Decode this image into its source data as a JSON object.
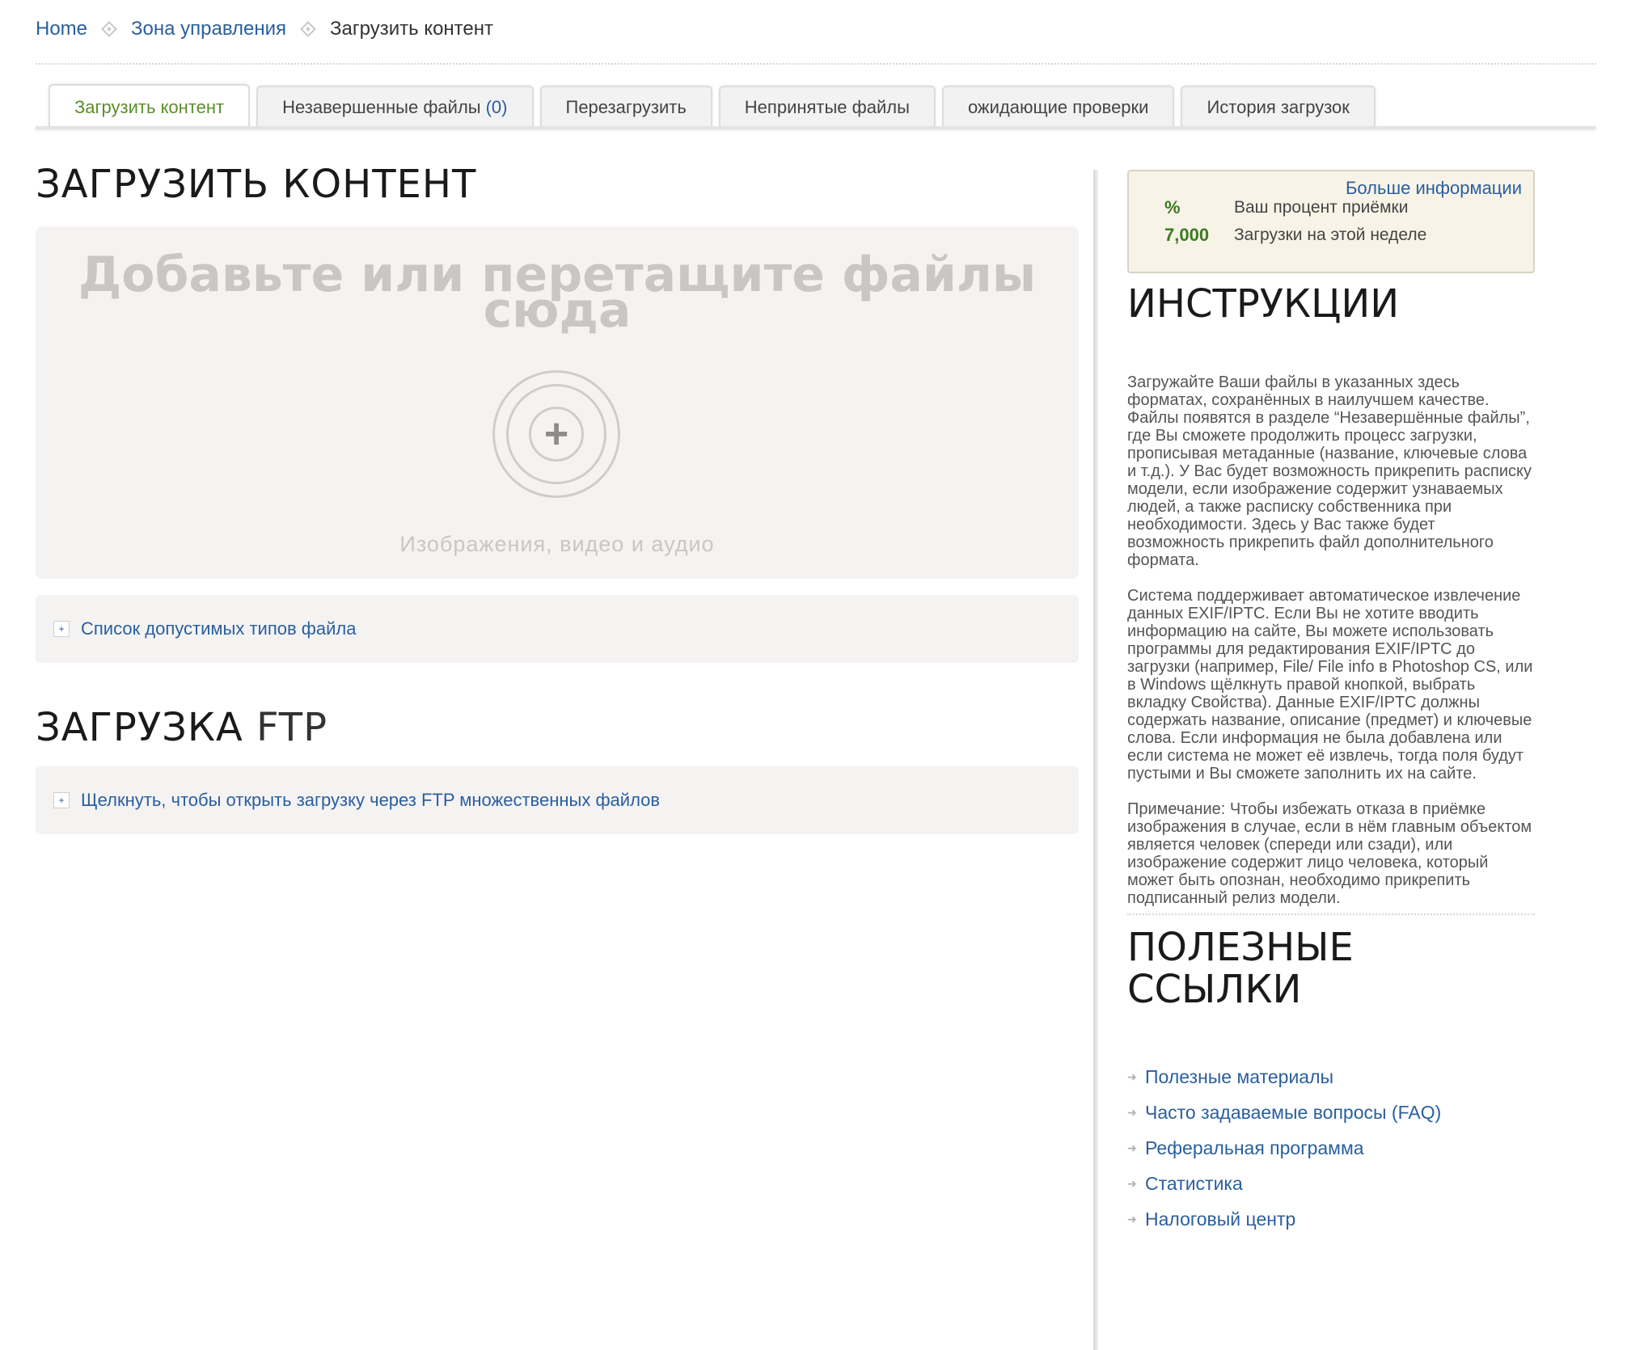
{
  "breadcrumb": {
    "home": "Home",
    "zone": "Зона управления",
    "current": "Загрузить контент"
  },
  "tabs": [
    {
      "label": "Загрузить контент"
    },
    {
      "label": "Незавершенные файлы",
      "count": "(0)"
    },
    {
      "label": "Перезагрузить"
    },
    {
      "label": "Непринятые файлы"
    },
    {
      "label": "ожидающие проверки"
    },
    {
      "label": "История загрузок"
    }
  ],
  "main": {
    "title": "ЗАГРУЗИТЬ КОНТЕНТ",
    "dropzone": {
      "title": "Добавьте или перетащите файлы сюда",
      "icon": "plus-target-icon",
      "subtitle": "Изображения, видео и аудио"
    },
    "file_types_link": "Список допустимых типов файла",
    "ftp_title_bold": "ЗАГРУЗКА",
    "ftp_title_light": "FTP",
    "ftp_link": "Щелкнуть, чтобы открыть загрузку через FTP множественных файлов"
  },
  "sidebar": {
    "more_info": "Больше информации",
    "stats": [
      {
        "value": "%",
        "label": "Ваш процент приёмки"
      },
      {
        "value": "7,000",
        "label": "Загрузки на этой неделе"
      }
    ],
    "instructions_title": "ИНСТРУКЦИИ",
    "instructions": [
      "Загружайте Ваши файлы в указанных здесь форматах, сохранённых в наилучшем качестве. Файлы появятся в разделе “Незавершённые файлы”, где Вы сможете продолжить процесс загрузки, прописывая метаданные (название, ключевые слова и т.д.). У Вас будет возможность прикрепить расписку модели, если изображение содержит узнаваемых людей, а также расписку собственника при необходимости. Здесь у Вас также будет возможность прикрепить файл дополнительного формата.",
      "Система поддерживает автоматическое извлечение данных EXIF/IPTC. Если Вы не хотите вводить информацию на сайте, Вы можете использовать программы для редактирования EXIF/IPTC до загрузки (например, File/ File info в Photoshop CS, или в Windows щёлкнуть правой кнопкой, выбрать вкладку Свойства). Данные EXIF/IPTC должны содержать название, описание (предмет) и ключевые слова. Если информация не была добавлена или если система не может её извлечь, тогда поля будут пустыми и Вы сможете заполнить их на сайте.",
      "Примечание: Чтобы избежать отказа в приёмке изображения в случае, если в нём главным объектом является человек (спереди или сзади), или изображение содержит лицо человека, который может быть опознан, необходимо прикрепить подписанный релиз модели."
    ],
    "links_title_line1": "ПОЛЕЗНЫЕ",
    "links_title_line2": "ССЫЛКИ",
    "links": [
      "Полезные материалы",
      "Часто задаваемые вопросы (FAQ)",
      "Реферальная программа",
      "Статистика",
      "Налоговый центр"
    ]
  },
  "colors": {
    "link": "#2a5f9e",
    "active_tab": "#5b8e2a",
    "stat_value": "#3b7a21",
    "stats_bg": "#f7f3e6",
    "panel_bg": "#f5f3f2"
  }
}
